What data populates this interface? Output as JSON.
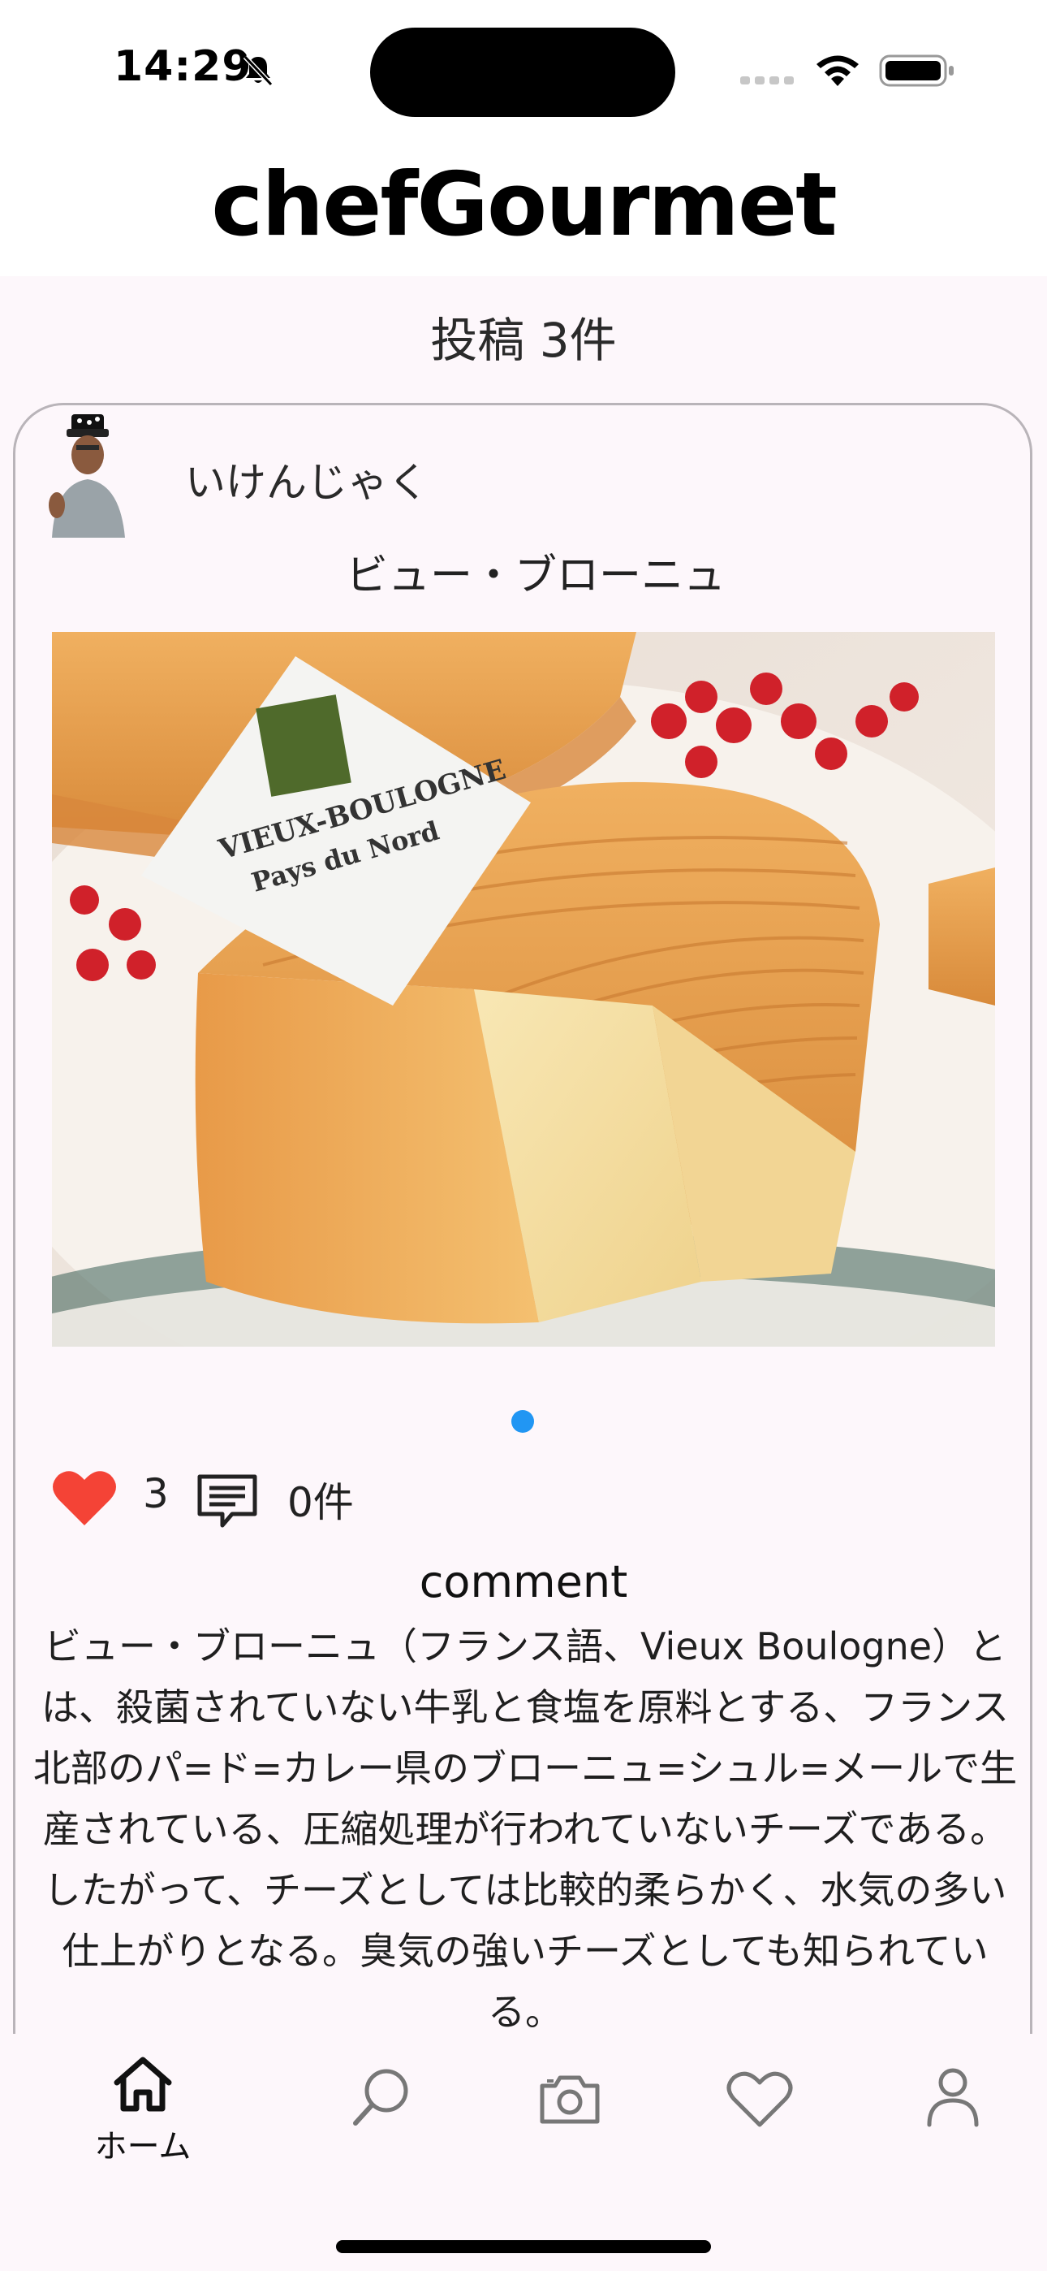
{
  "status_bar": {
    "time": "14:29"
  },
  "app": {
    "title": "chefGourmet"
  },
  "feed": {
    "post_count_label": "投稿 3件"
  },
  "post": {
    "username": "いけんじゃく",
    "title": "ビュー・ブローニュ",
    "image_label": {
      "line1": "VIEUX-BOULOGNE",
      "line2": "Pays du Nord"
    },
    "likes": "3",
    "comments": "0件",
    "comment_heading": "comment",
    "comment_text": "ビュー・ブローニュ（フランス語、Vieux Boulogne）とは、殺菌されていない牛乳と食塩を原料とする、フランス北部のパ=ド=カレー県のブローニュ=シュル=メールで生産されている、圧縮処理が行われていないチーズである。したがって、チーズとしては比較的柔らかく、水気の多い仕上がりとなる。臭気の強いチーズとしても知られている。"
  },
  "bottom_nav": {
    "items": [
      {
        "label": "ホーム",
        "icon": "home-icon",
        "active": true
      },
      {
        "label": "",
        "icon": "search-icon",
        "active": false
      },
      {
        "label": "",
        "icon": "camera-icon",
        "active": false
      },
      {
        "label": "",
        "icon": "heart-outline-icon",
        "active": false
      },
      {
        "label": "",
        "icon": "person-icon",
        "active": false
      }
    ]
  },
  "colors": {
    "background": "#fdf7fb",
    "like_red": "#f44336",
    "page_dot": "#2196f3"
  }
}
